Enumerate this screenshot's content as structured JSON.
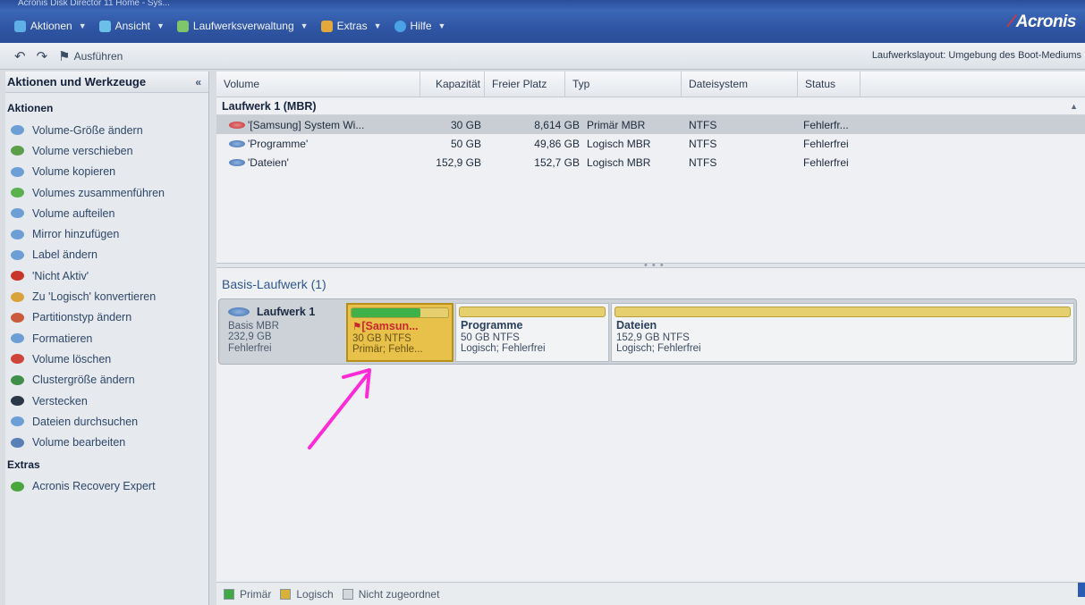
{
  "window": {
    "title": "Acronis Disk Director 11 Home - Sys..."
  },
  "menu": [
    {
      "label": "Aktionen",
      "icon": "actions-icon",
      "color": "#5fb0e6"
    },
    {
      "label": "Ansicht",
      "icon": "view-icon",
      "color": "#6bc0e8"
    },
    {
      "label": "Laufwerksverwaltung",
      "icon": "disk-management-icon",
      "color": "#7fc66a"
    },
    {
      "label": "Extras",
      "icon": "tools-icon",
      "color": "#e3a93c"
    },
    {
      "label": "Hilfe",
      "icon": "help-icon",
      "color": "#49a3e6"
    }
  ],
  "brand": "Acronis",
  "toolbar": {
    "undo_label": "",
    "redo_label": "",
    "execute_label": "Ausführen",
    "layout_label": "Laufwerkslayout: Umgebung des Boot-Mediums"
  },
  "sidebar": {
    "title": "Aktionen und Werkzeuge",
    "section_actions": "Aktionen",
    "items": [
      {
        "label": "Volume-Größe ändern",
        "icon": "resize-volume-icon",
        "color": "#6d9fd6"
      },
      {
        "label": "Volume verschieben",
        "icon": "move-volume-icon",
        "color": "#5c9e4a"
      },
      {
        "label": "Volume kopieren",
        "icon": "copy-volume-icon",
        "color": "#6d9fd6"
      },
      {
        "label": "Volumes zusammenführen",
        "icon": "merge-volumes-icon",
        "color": "#5bb04f"
      },
      {
        "label": "Volume aufteilen",
        "icon": "split-volume-icon",
        "color": "#6d9fd6"
      },
      {
        "label": "Mirror hinzufügen",
        "icon": "add-mirror-icon",
        "color": "#6d9fd6"
      },
      {
        "label": "Label ändern",
        "icon": "change-label-icon",
        "color": "#6d9fd6"
      },
      {
        "label": "'Nicht Aktiv'",
        "icon": "set-inactive-icon",
        "color": "#c8352b"
      },
      {
        "label": "Zu 'Logisch' konvertieren",
        "icon": "convert-logical-icon",
        "color": "#d9a23a"
      },
      {
        "label": "Partitionstyp ändern",
        "icon": "partition-type-icon",
        "color": "#c95a3a"
      },
      {
        "label": "Formatieren",
        "icon": "format-icon",
        "color": "#6d9fd6"
      },
      {
        "label": "Volume löschen",
        "icon": "delete-volume-icon",
        "color": "#d0453b"
      },
      {
        "label": "Clustergröße ändern",
        "icon": "cluster-size-icon",
        "color": "#3f8f4a"
      },
      {
        "label": "Verstecken",
        "icon": "hide-icon",
        "color": "#2b3646"
      },
      {
        "label": "Dateien durchsuchen",
        "icon": "browse-files-icon",
        "color": "#6d9fd6"
      },
      {
        "label": "Volume bearbeiten",
        "icon": "edit-volume-icon",
        "color": "#5a7fb5"
      }
    ],
    "section_extras": "Extras",
    "extras_items": [
      {
        "label": "Acronis Recovery Expert",
        "icon": "recovery-expert-icon",
        "color": "#4aa63d"
      }
    ]
  },
  "grid": {
    "columns": [
      "Volume",
      "Kapazität",
      "Freier Platz",
      "Typ",
      "Dateisystem",
      "Status"
    ],
    "group": "Laufwerk 1 (MBR)",
    "rows": [
      {
        "volume": "'[Samsung] System Wi...",
        "capacity": "30 GB",
        "free": "8,614 GB",
        "type": "Primär MBR",
        "fs": "NTFS",
        "status": "Fehlerfr...",
        "selected": true
      },
      {
        "volume": "'Programme'",
        "capacity": "50 GB",
        "free": "49,86 GB",
        "type": "Logisch MBR",
        "fs": "NTFS",
        "status": "Fehlerfrei",
        "selected": false
      },
      {
        "volume": "'Dateien'",
        "capacity": "152,9 GB",
        "free": "152,7 GB",
        "type": "Logisch MBR",
        "fs": "NTFS",
        "status": "Fehlerfrei",
        "selected": false
      }
    ]
  },
  "basis": {
    "title": "Basis-Laufwerk (1)",
    "disk": {
      "name": "Laufwerk 1",
      "line1": "Basis MBR",
      "line2": "232,9 GB",
      "line3": "Fehlerfrei"
    },
    "partitions": [
      {
        "name": "[Samsun...",
        "size": "30 GB NTFS",
        "state": "Primär; Fehle...",
        "used_fraction": 0.71
      },
      {
        "name": "Programme",
        "size": "50 GB NTFS",
        "state": "Logisch; Fehlerfrei",
        "used_fraction": 0.0
      },
      {
        "name": "Dateien",
        "size": "152,9 GB NTFS",
        "state": "Logisch; Fehlerfrei",
        "used_fraction": 0.0
      }
    ]
  },
  "legend": [
    {
      "label": "Primär",
      "color": "#3fa945"
    },
    {
      "label": "Logisch",
      "color": "#d6b23a"
    },
    {
      "label": "Nicht zugeordnet",
      "color": "#d3d6da"
    }
  ],
  "colors": {
    "menubar": "#2f56a4",
    "annotation_arrow": "#ff2bd6",
    "selection": "#e8c14a"
  }
}
